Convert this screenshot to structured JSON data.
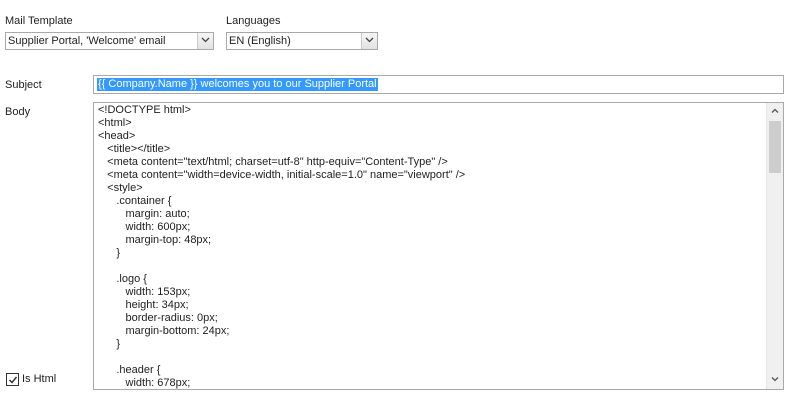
{
  "mail_template": {
    "label": "Mail Template",
    "selected": "Supplier Portal, 'Welcome' email",
    "icon": "chevron-down-icon"
  },
  "languages": {
    "label": "Languages",
    "selected": "EN (English)",
    "icon": "chevron-down-icon"
  },
  "subject": {
    "label": "Subject",
    "value": "{{ Company.Name }} welcomes you to our Supplier Portal"
  },
  "body": {
    "label": "Body",
    "lines": [
      "<!DOCTYPE html>",
      "<html>",
      "<head>",
      "    <title></title>",
      "    <meta content=\"text/html; charset=utf-8\" http-equiv=\"Content-Type\" />",
      "    <meta content=\"width=device-width, initial-scale=1.0\" name=\"viewport\" />",
      "    <style>",
      "        .container {",
      "            margin: auto;",
      "            width: 600px;",
      "            margin-top: 48px;",
      "        }",
      "",
      "        .logo {",
      "            width: 153px;",
      "            height: 34px;",
      "            border-radius: 0px;",
      "            margin-bottom: 24px;",
      "        }",
      "",
      "        .header {",
      "            width: 678px;"
    ]
  },
  "is_html": {
    "label": "Is Html",
    "checked": true
  }
}
